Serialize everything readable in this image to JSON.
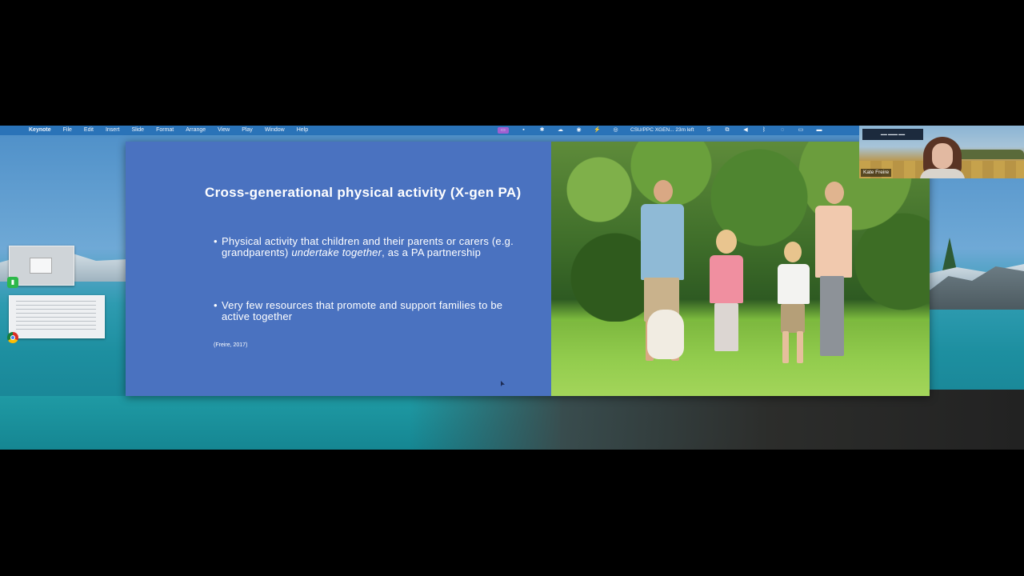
{
  "menubar": {
    "apple_glyph": "",
    "items": [
      "Keynote",
      "File",
      "Edit",
      "Insert",
      "Slide",
      "Format",
      "Arrange",
      "View",
      "Play",
      "Window",
      "Help"
    ],
    "meeting_status": "CSU/PPC XGEN... 23m left"
  },
  "video": {
    "participant_name": "Kate Freire"
  },
  "slide": {
    "title": "Cross-generational physical activity (X-gen PA)",
    "bullet1_plain": "Physical activity that children and their parents or carers (e.g. grandparents) ",
    "bullet1_italic": "undertake together",
    "bullet1_tail": ", as a PA partnership",
    "bullet2": "Very few resources that promote and support families to be active together",
    "citation": "(Freire, 2017)",
    "bullet_glyph": "•"
  },
  "colors": {
    "slide_bg": "#4a72c0",
    "menubar_bg": "#2a73b8"
  }
}
